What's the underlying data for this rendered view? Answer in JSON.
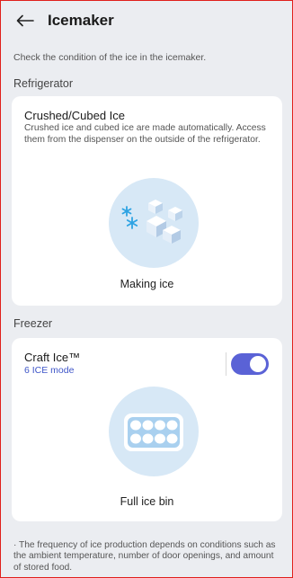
{
  "header": {
    "back_icon": "arrow-left-icon",
    "title": "Icemaker"
  },
  "intro_text": "Check the condition of the ice in the icemaker.",
  "refrigerator": {
    "section_title": "Refrigerator",
    "card_title": "Crushed/Cubed Ice",
    "description": "Crushed ice and cubed ice are made automatically. Access them from the dispenser on the outside of the refrigerator.",
    "illustration_icon": "ice-cubes-snowflake-icon",
    "status": "Making ice"
  },
  "freezer": {
    "section_title": "Freezer",
    "card_title": "Craft Ice™",
    "mode": "6 ICE mode",
    "toggle_on": true,
    "illustration_icon": "ice-bin-icon",
    "status": "Full ice bin"
  },
  "footnote": "· The frequency of ice production depends on conditions such as the ambient temperature, number of door openings, and amount of stored food.",
  "colors": {
    "accent": "#5a62d6",
    "page_bg": "#ebedf1",
    "card_bg": "#ffffff",
    "illustration_bg": "#d7e8f6"
  }
}
